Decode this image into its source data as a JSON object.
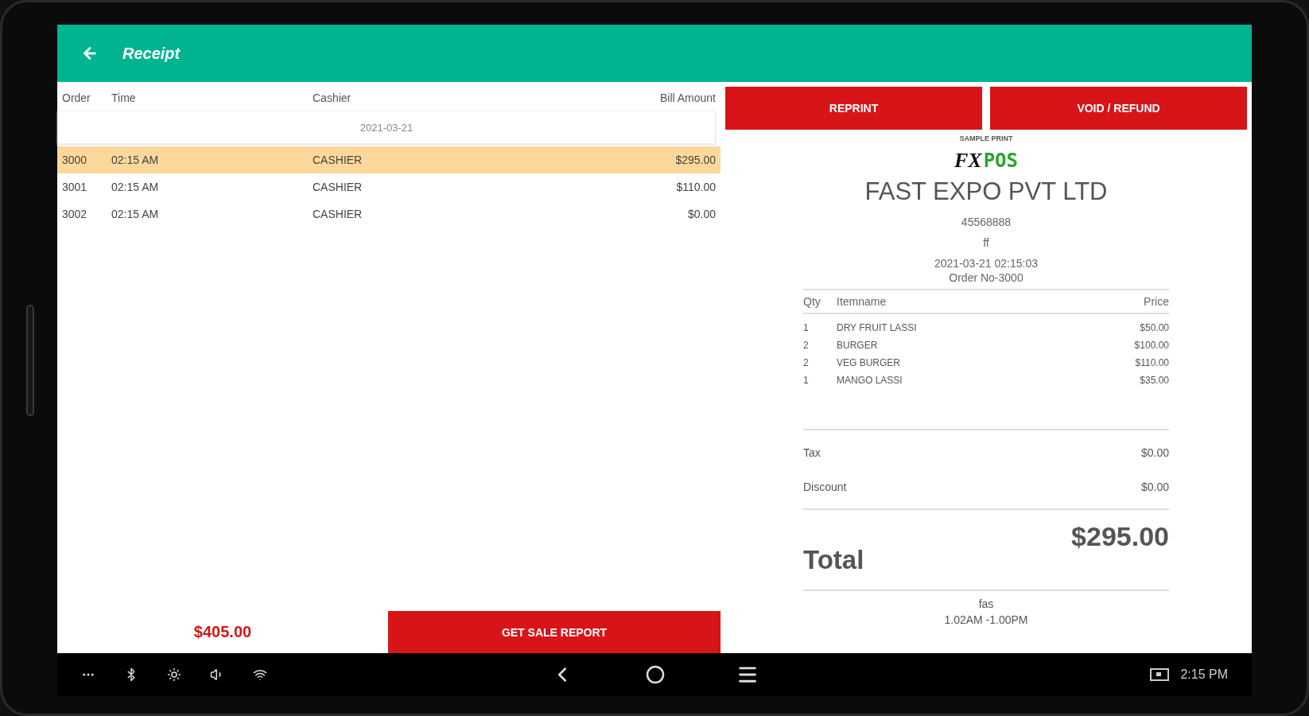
{
  "app_bar": {
    "title": "Receipt"
  },
  "orders": {
    "columns": [
      "Order",
      "Time",
      "Cashier",
      "Bill Amount"
    ],
    "date": "2021-03-21",
    "rows": [
      {
        "order": "3000",
        "time": "02:15 AM",
        "cashier": "CASHIER",
        "amount": "$295.00",
        "selected": true
      },
      {
        "order": "3001",
        "time": "02:15 AM",
        "cashier": "CASHIER",
        "amount": "$110.00",
        "selected": false
      },
      {
        "order": "3002",
        "time": "02:15 AM",
        "cashier": "CASHIER",
        "amount": "$0.00",
        "selected": false
      }
    ]
  },
  "sales_total": "$405.00",
  "report_button": "GET SALE REPORT",
  "actions": [
    "REPRINT",
    "VOID / REFUND"
  ],
  "receipt": {
    "caption": "SAMPLE PRINT",
    "logo": [
      "FX",
      "POS"
    ],
    "company": "FAST EXPO PVT LTD",
    "phone": "45568888",
    "line": "ff",
    "datetime": "2021-03-21 02:15:03",
    "order_no": "Order No-3000",
    "columns": [
      "Qty",
      "Itemname",
      "Price"
    ],
    "items": [
      {
        "qty": "1",
        "name": "DRY FRUIT LASSI",
        "price": "$50.00"
      },
      {
        "qty": "2",
        "name": "BURGER",
        "price": "$100.00"
      },
      {
        "qty": "2",
        "name": "VEG BURGER",
        "price": "$110.00"
      },
      {
        "qty": "1",
        "name": "MANGO LASSI",
        "price": "$35.00"
      }
    ],
    "summary": [
      {
        "label": "Tax",
        "value": "$0.00"
      },
      {
        "label": "Discount",
        "value": "$0.00"
      }
    ],
    "total": {
      "label": "Total",
      "value": "$295.00"
    },
    "footer": [
      "fas",
      "1.02AM -1.00PM"
    ]
  },
  "nav_bar": {
    "time": "2:15 PM"
  }
}
